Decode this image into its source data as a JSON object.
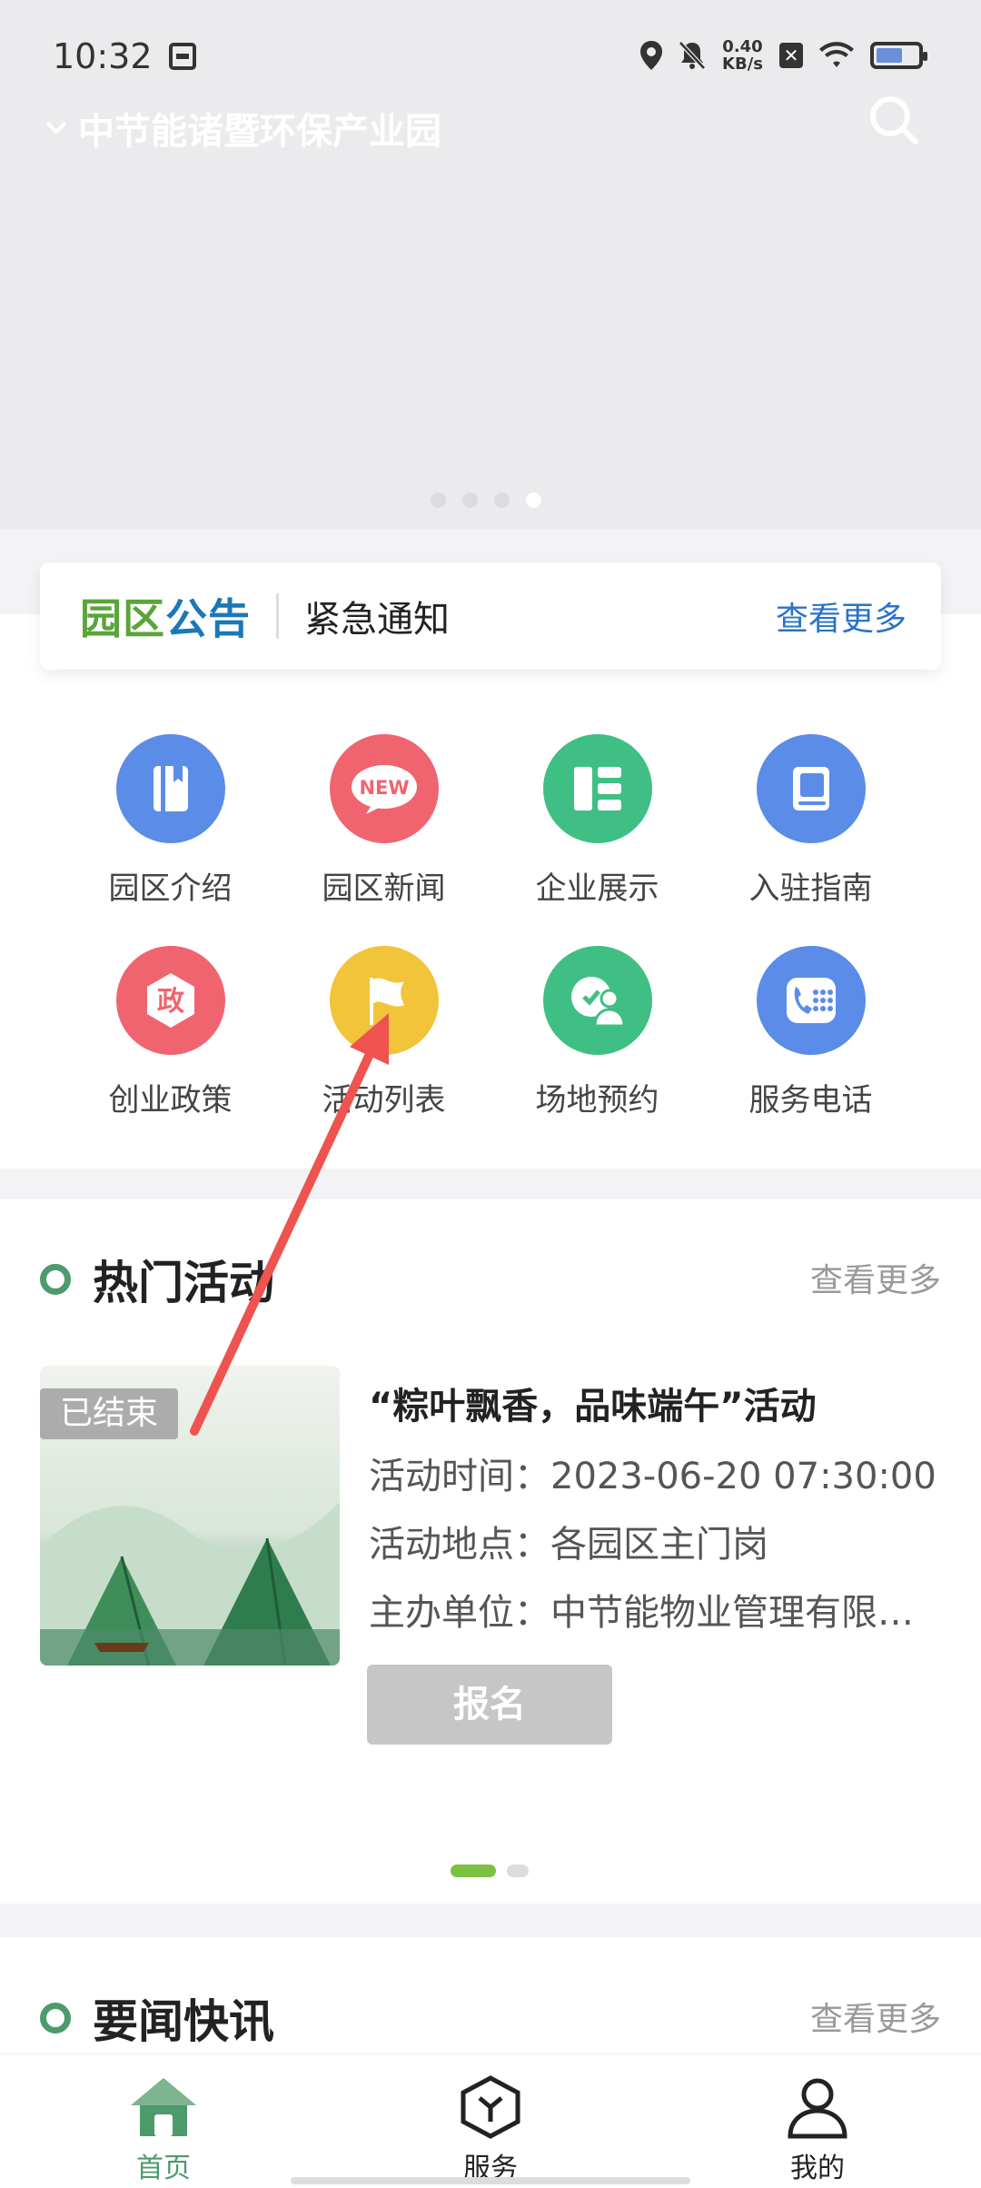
{
  "status_bar": {
    "time": "10:32",
    "speed_top": "0.40",
    "speed_bottom": "KB/s"
  },
  "header": {
    "location": "中节能诸暨环保产业园"
  },
  "notice": {
    "logo_part1": "园区",
    "logo_part2": "公告",
    "text": "紧急通知",
    "more": "查看更多"
  },
  "grid": [
    {
      "label": "园区介绍",
      "icon": "book-icon",
      "color": "#5b8ce8"
    },
    {
      "label": "园区新闻",
      "icon": "new-badge-icon",
      "color": "#f06470"
    },
    {
      "label": "企业展示",
      "icon": "list-icon",
      "color": "#3fbf84"
    },
    {
      "label": "入驻指南",
      "icon": "guide-icon",
      "color": "#5b8ce8"
    },
    {
      "label": "创业政策",
      "icon": "policy-icon",
      "color": "#f06470"
    },
    {
      "label": "活动列表",
      "icon": "flag-icon",
      "color": "#f2c43a"
    },
    {
      "label": "场地预约",
      "icon": "venue-icon",
      "color": "#3fbf84"
    },
    {
      "label": "服务电话",
      "icon": "phone-icon",
      "color": "#5b8ce8"
    }
  ],
  "grid_glyphs": {
    "new": "NEW",
    "policy": "政"
  },
  "hot": {
    "title": "热门活动",
    "more": "查看更多",
    "item": {
      "status": "已结束",
      "title": "“粽叶飘香，品味端午”活动",
      "time": "活动时间：2023-06-20 07:30:00",
      "place": "活动地点：各园区主门岗",
      "host": "主办单位：中节能物业管理有限公司",
      "button": "报名"
    }
  },
  "news": {
    "title": "要闻快讯",
    "more": "查看更多"
  },
  "tabs": [
    {
      "label": "首页",
      "icon": "home-icon",
      "active": true
    },
    {
      "label": "服务",
      "icon": "service-icon",
      "active": false
    },
    {
      "label": "我的",
      "icon": "user-icon",
      "active": false
    }
  ],
  "colors": {
    "accent": "#4d9a6c",
    "link": "#2a72c8",
    "arrow": "#ee5350"
  }
}
